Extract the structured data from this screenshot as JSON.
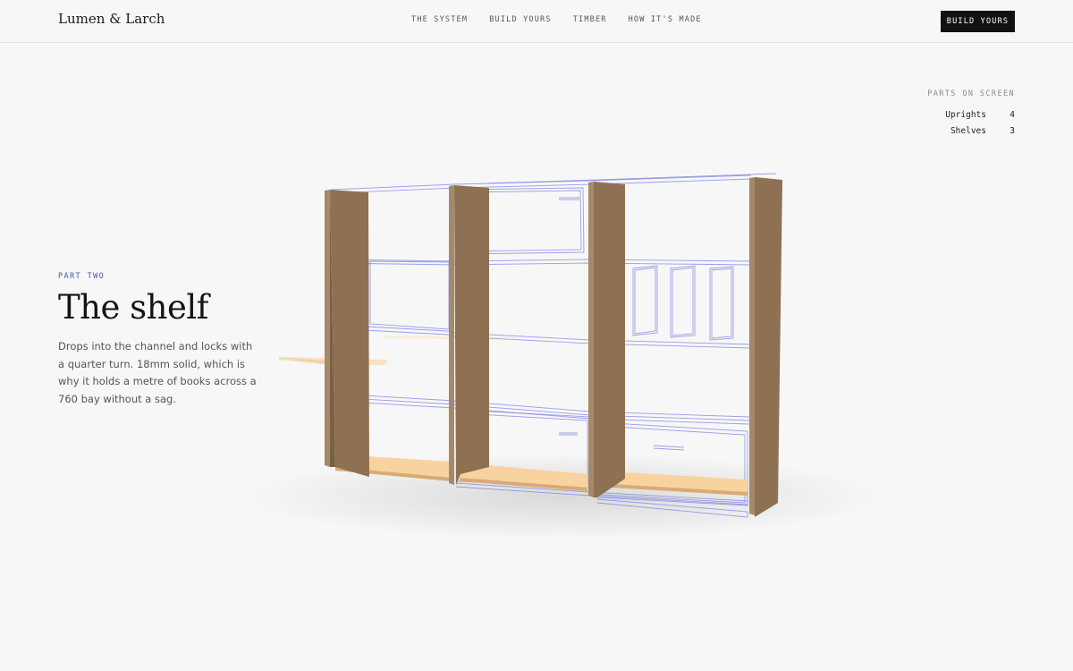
{
  "brand": {
    "name": "Lumen & Larch"
  },
  "nav": {
    "items": [
      {
        "label": "THE SYSTEM"
      },
      {
        "label": "BUILD YOURS"
      },
      {
        "label": "TIMBER"
      },
      {
        "label": "HOW IT'S MADE"
      }
    ],
    "cta_label": "BUILD YOURS"
  },
  "parts_panel": {
    "title": "PARTS ON SCREEN",
    "rows": [
      {
        "label": "Uprights",
        "count": "4"
      },
      {
        "label": "Shelves",
        "count": "3"
      }
    ]
  },
  "section": {
    "eyebrow": "PART TWO",
    "title": "The shelf",
    "body": "Drops into the channel and locks with a quarter turn. 18mm solid, which is why it holds a metre of books across a 760 bay without a sag."
  },
  "colors": {
    "background": "#f7f7f7",
    "accent": "#4a55a8",
    "wireframe": "#7c82e0",
    "upright_wood": "#8e7152",
    "shelf_wood": "#f8d3a0",
    "cta_background": "#121212"
  }
}
